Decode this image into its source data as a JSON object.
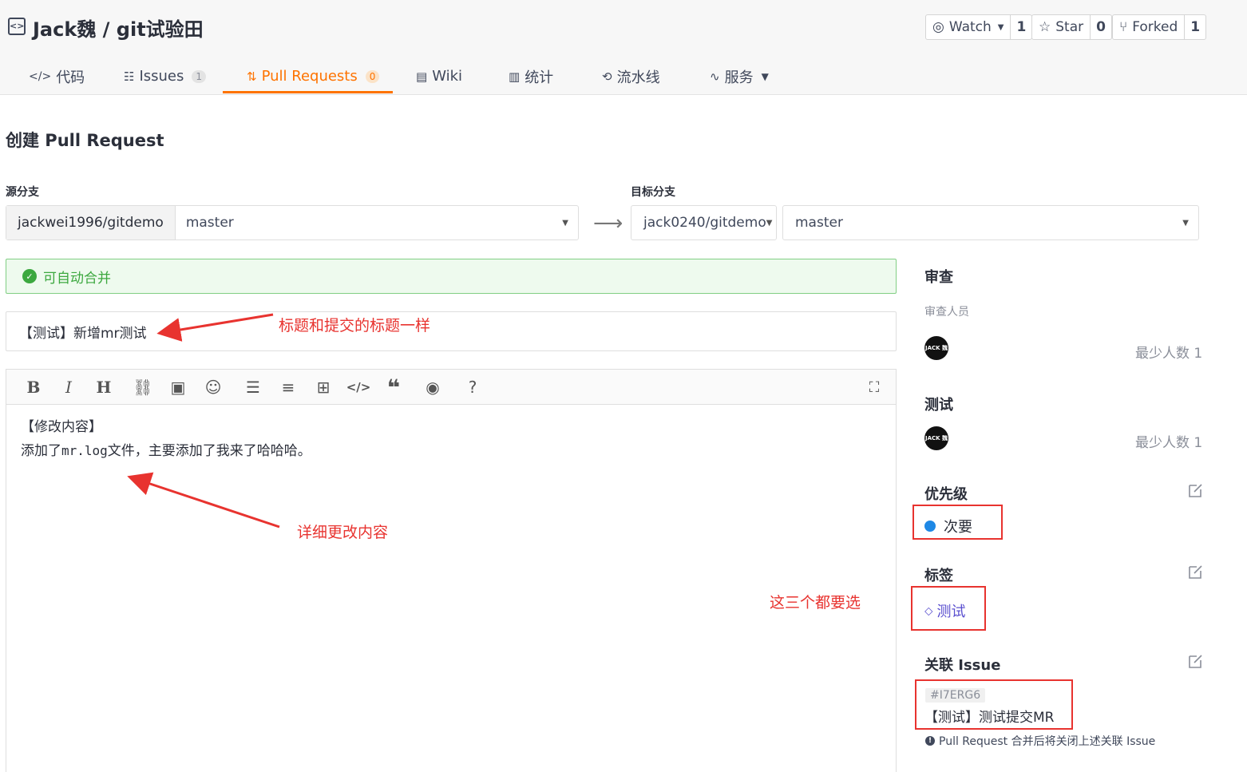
{
  "repo": {
    "title": "Jack魏 / git试验田"
  },
  "actions": {
    "watch_label": "Watch",
    "watch_count": "1",
    "star_label": "Star",
    "star_count": "0",
    "forked_label": "Forked",
    "forked_count": "1"
  },
  "tabs": [
    {
      "label": "代码"
    },
    {
      "label": "Issues",
      "badge": "1"
    },
    {
      "label": "Pull Requests",
      "badge": "0"
    },
    {
      "label": "Wiki"
    },
    {
      "label": "统计"
    },
    {
      "label": "流水线"
    },
    {
      "label": "服务"
    }
  ],
  "page": {
    "title": "创建 Pull Request"
  },
  "source": {
    "label": "源分支",
    "repo": "jackwei1996/gitdemo",
    "branch": "master"
  },
  "target": {
    "label": "目标分支",
    "repo": "jack0240/gitdemo",
    "branch": "master"
  },
  "merge_status": "可自动合并",
  "pr_title": "【测试】新增mr测试",
  "editor": {
    "line1": "【修改内容】",
    "line2_a": "添加了",
    "line2_code": "mr.log",
    "line2_b": "文件，主要添加了我来了哈哈哈。"
  },
  "annotations": {
    "title_note": "标题和提交的标题一样",
    "body_note": "详细更改内容",
    "select_note": "这三个都要选"
  },
  "sidebar": {
    "review_heading": "审查",
    "reviewers_label": "审查人员",
    "reviewer_min": "最少人数 1",
    "test_heading": "测试",
    "tester_min": "最少人数 1",
    "avatar_text": "JACK 魏",
    "priority_heading": "优先级",
    "priority_value": "次要",
    "labels_heading": "标签",
    "label_value": "测试",
    "issue_heading": "关联 Issue",
    "issue_id": "#I7ERG6",
    "issue_title": "【测试】测试提交MR",
    "issue_note": "Pull Request 合并后将关闭上述关联 Issue"
  },
  "colors": {
    "accent": "#fe7300",
    "success": "#3ca83f",
    "annotation": "#e8332f",
    "priority": "#1e88e5"
  }
}
